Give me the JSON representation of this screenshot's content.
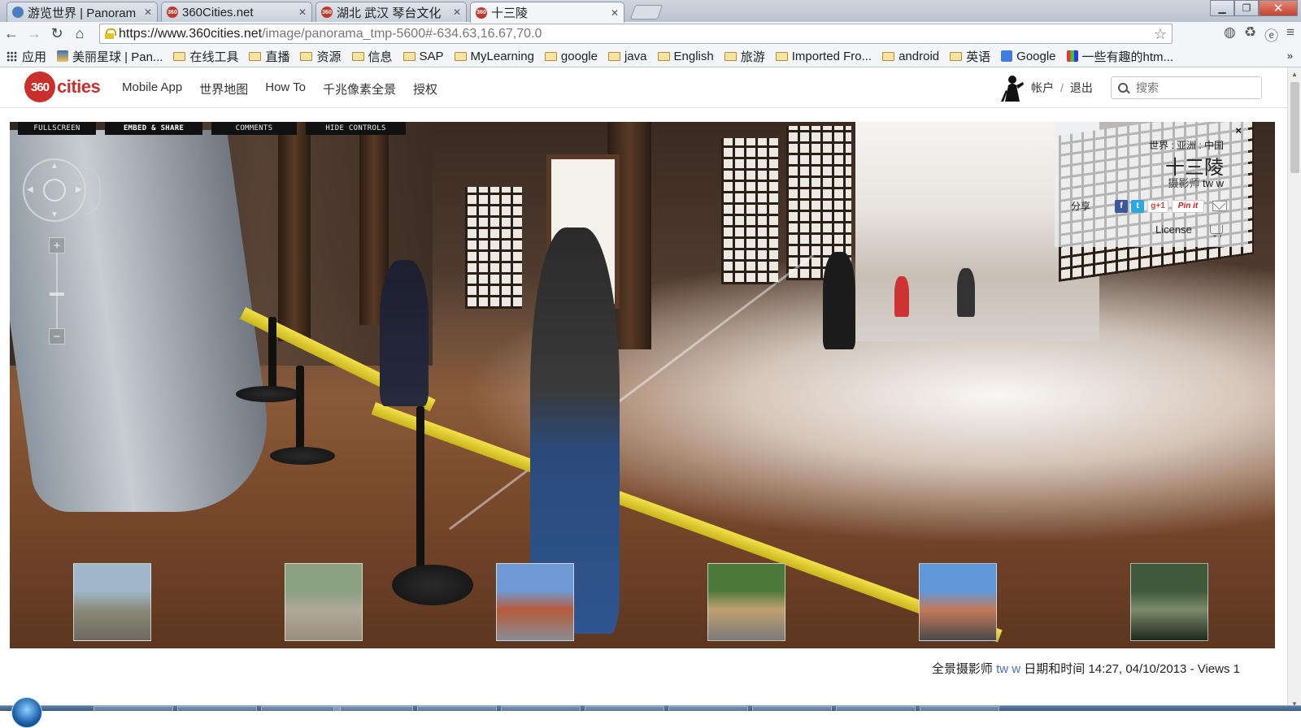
{
  "browser": {
    "tabs": [
      {
        "label": "游览世界 | Panoram",
        "active": false
      },
      {
        "label": "360Cities.net",
        "active": false
      },
      {
        "label": "湖北 武汉 琴台文化",
        "active": false
      },
      {
        "label": "十三陵",
        "active": true
      }
    ],
    "url_host": "https://www.360cities.net",
    "url_path": "/image/panorama_tmp-5600#-634.63,16.67,70.0",
    "bookmarks": [
      {
        "label": "应用",
        "type": "apps"
      },
      {
        "label": "美丽星球 | Pan...",
        "type": "site"
      },
      {
        "label": "在线工具",
        "type": "folder"
      },
      {
        "label": "直播",
        "type": "folder"
      },
      {
        "label": "资源",
        "type": "folder"
      },
      {
        "label": "信息",
        "type": "folder"
      },
      {
        "label": "SAP",
        "type": "folder"
      },
      {
        "label": "MyLearning",
        "type": "folder"
      },
      {
        "label": "google",
        "type": "folder"
      },
      {
        "label": "java",
        "type": "folder"
      },
      {
        "label": "English",
        "type": "folder"
      },
      {
        "label": "旅游",
        "type": "folder"
      },
      {
        "label": "Imported Fro...",
        "type": "folder"
      },
      {
        "label": "android",
        "type": "folder"
      },
      {
        "label": "英语",
        "type": "folder"
      },
      {
        "label": "Google",
        "type": "site"
      },
      {
        "label": "一些有趣的htm...",
        "type": "site"
      }
    ],
    "bookmarks_more": "»"
  },
  "site": {
    "logo_num": "360",
    "logo_word": "cities",
    "nav": [
      "Mobile App",
      "世界地图",
      "How To",
      "千兆像素全景",
      "授权"
    ],
    "account": "帐户",
    "separator": "/",
    "logout": "退出",
    "search_placeholder": "搜索"
  },
  "viewer": {
    "buttons": [
      "FULLSCREEN",
      "EMBED & SHARE",
      "COMMENTS",
      "HIDE CONTROLS"
    ],
    "zoom_in": "+",
    "zoom_out": "−",
    "close": "×",
    "breadcrumb": "世界 : 亚洲 : 中国",
    "title": "十三陵",
    "photographer_prefix": "摄影师",
    "photographer": "tw w",
    "share_label": "分享",
    "fb": "f",
    "tw": "t",
    "gplus": "g+1",
    "pinit": "Pin it",
    "license": "License",
    "thumbnails": [
      {
        "name": "great-wall",
        "colors": [
          "#9fb8cc",
          "#8a8a7a",
          "#6e6a5e"
        ]
      },
      {
        "name": "stone-stele",
        "colors": [
          "#8aa080",
          "#b0a89a",
          "#9a8e7c"
        ]
      },
      {
        "name": "plaza-gate",
        "colors": [
          "#6f9ad4",
          "#b65a3a",
          "#8a8d94"
        ]
      },
      {
        "name": "trees-crowd",
        "colors": [
          "#4d7a3a",
          "#c0a070",
          "#7a7a7a"
        ]
      },
      {
        "name": "tourists-square",
        "colors": [
          "#5e98d8",
          "#c47a5a",
          "#4a4a4a"
        ]
      },
      {
        "name": "green-cave",
        "colors": [
          "#3e5a3a",
          "#7a8a6a",
          "#1e2a1e"
        ]
      }
    ]
  },
  "footer": {
    "label": "全景摄影师",
    "photographer": "tw w",
    "datetime_label": "日期和时间",
    "datetime": "14:27, 04/10/2013",
    "views": "- Views 1"
  }
}
